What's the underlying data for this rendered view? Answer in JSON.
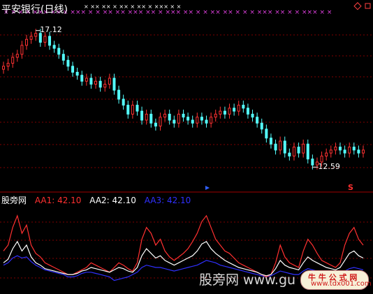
{
  "title": "平安银行(日线)",
  "price_chart": {
    "high_label": "17.12",
    "low_label": "12.59",
    "sell_marker": "S",
    "up_color": "#ff3232",
    "down_color": "#54ffff",
    "gridline_color": "#800000",
    "closes": [
      15.9,
      16.0,
      16.2,
      16.3,
      16.6,
      16.8,
      16.9,
      17.0,
      16.7,
      16.9,
      16.6,
      16.5,
      16.3,
      16.1,
      15.9,
      15.7,
      15.6,
      15.4,
      15.5,
      15.3,
      15.4,
      15.2,
      15.3,
      15.5,
      15.1,
      14.8,
      14.6,
      14.3,
      14.6,
      14.4,
      14.1,
      14.3,
      14.0,
      13.9,
      14.2,
      14.3,
      14.1,
      14.0,
      14.3,
      14.2,
      14.1,
      14.0,
      14.2,
      14.1,
      14.0,
      14.2,
      14.3,
      14.4,
      14.3,
      14.5,
      14.4,
      14.6,
      14.5,
      14.3,
      14.2,
      14.0,
      13.8,
      13.5,
      13.3,
      13.1,
      13.4,
      13.0,
      12.9,
      13.2,
      13.0,
      13.3,
      12.8,
      12.6,
      12.7,
      12.9,
      13.0,
      13.1,
      13.2,
      13.1,
      13.0,
      13.2,
      13.1,
      13.0,
      13.1
    ],
    "marks_top_magenta": "× × ×  × ××× ××  × ××× × × ×× ×× ××× ×× × ×××  ×× × × ×× ×× × × × ××× ×× × × ××× × ×",
    "marks_top_white": "× ×× ×× × ×× × ×× × ××× × ×"
  },
  "indicator": {
    "name": "股旁网",
    "aa1": {
      "label": "AA1: 42.10",
      "color": "#ff3030"
    },
    "aa2": {
      "label": "AA2: 42.10",
      "color": "#ffffff"
    },
    "aa3": {
      "label": "AA3: 42.10",
      "color": "#3030ff"
    },
    "aa1_values": [
      50,
      55,
      70,
      80,
      65,
      72,
      55,
      48,
      45,
      40,
      38,
      36,
      34,
      32,
      30,
      30,
      32,
      34,
      36,
      40,
      38,
      36,
      34,
      32,
      36,
      40,
      38,
      35,
      33,
      40,
      60,
      70,
      65,
      55,
      60,
      50,
      45,
      42,
      45,
      48,
      52,
      58,
      65,
      75,
      80,
      70,
      60,
      55,
      50,
      48,
      44,
      40,
      38,
      36,
      34,
      32,
      30,
      28,
      30,
      40,
      55,
      45,
      40,
      38,
      36,
      50,
      60,
      55,
      48,
      42,
      40,
      38,
      36,
      40,
      55,
      65,
      70,
      60,
      55
    ],
    "aa2_values": [
      40,
      43,
      52,
      58,
      50,
      55,
      45,
      40,
      38,
      35,
      34,
      33,
      32,
      31,
      30,
      30,
      31,
      33,
      34,
      36,
      35,
      34,
      33,
      32,
      34,
      36,
      35,
      33,
      32,
      36,
      46,
      52,
      48,
      44,
      46,
      42,
      40,
      38,
      40,
      42,
      44,
      46,
      50,
      56,
      58,
      52,
      48,
      45,
      42,
      40,
      38,
      36,
      35,
      34,
      33,
      32,
      30,
      29,
      30,
      35,
      42,
      38,
      36,
      35,
      34,
      40,
      45,
      42,
      40,
      38,
      36,
      35,
      34,
      36,
      42,
      48,
      50,
      46,
      44
    ],
    "aa3_values": [
      38,
      40,
      44,
      46,
      44,
      45,
      41,
      38,
      36,
      34,
      33,
      32,
      31,
      30,
      28,
      28,
      29,
      31,
      32,
      32,
      31,
      30,
      29,
      28,
      25,
      26,
      27,
      28,
      30,
      32,
      36,
      38,
      37,
      36,
      36,
      35,
      34,
      33,
      34,
      35,
      36,
      37,
      38,
      40,
      42,
      41,
      40,
      38,
      37,
      36,
      35,
      34,
      33,
      32,
      31,
      30,
      29,
      28,
      29,
      31,
      33,
      32,
      31,
      30,
      30,
      33,
      35,
      34,
      33,
      32,
      31,
      30,
      30,
      31,
      33,
      35,
      36,
      35,
      34
    ]
  },
  "watermark": "股旁网 www.gu",
  "badge": {
    "line1": "牛 牛 公 式 网",
    "line2": "www.tdx001.com"
  }
}
